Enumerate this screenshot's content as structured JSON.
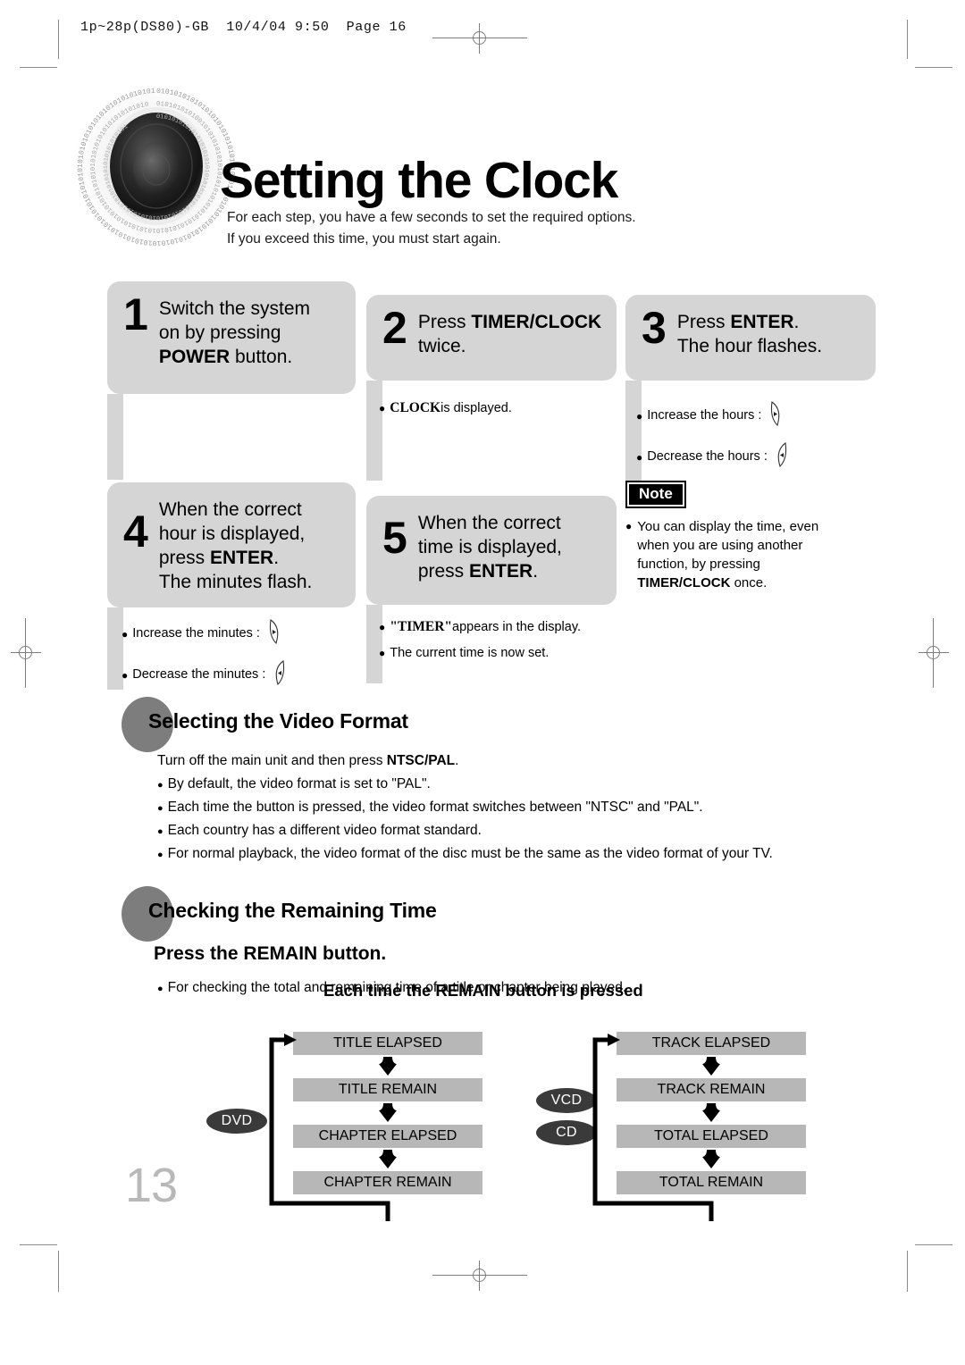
{
  "print_slug": "1p~28p(DS80)-GB  10/4/04 9:50  Page 16",
  "page_number": "13",
  "title": "Setting the Clock",
  "intro_line1": "For each step, you have a few seconds to set the required options.",
  "intro_line2": "If you exceed this time, you must start again.",
  "steps": [
    {
      "num": "1",
      "line1": "Switch the system",
      "line2": "on by pressing",
      "line3_bold": "POWER",
      "line3_rest": " button.",
      "notes": []
    },
    {
      "num": "2",
      "line1_pre": "Press ",
      "line1_bold": "TIMER/CLOCK",
      "line2": "twice.",
      "notes": [
        {
          "bold": "CLOCK",
          "rest": " is displayed."
        }
      ]
    },
    {
      "num": "3",
      "line1_pre": "Press ",
      "line1_bold": "ENTER",
      "line1_post": ".",
      "line2": "The hour flashes.",
      "notes": [
        {
          "label": "Increase the hours :",
          "key": "right-arrow-key-icon"
        },
        {
          "label": "Decrease the hours :",
          "key": "left-arrow-key-icon"
        }
      ]
    },
    {
      "num": "4",
      "line1": "When the correct",
      "line2": "hour is displayed,",
      "line3_pre": "press ",
      "line3_bold": "ENTER",
      "line3_post": ".",
      "line4": "The minutes flash.",
      "notes": [
        {
          "label": "Increase the minutes :",
          "key": "right-arrow-key-icon"
        },
        {
          "label": "Decrease the minutes :",
          "key": "left-arrow-key-icon"
        }
      ]
    },
    {
      "num": "5",
      "line1": "When the correct",
      "line2": "time is displayed,",
      "line3_pre": "press ",
      "line3_bold": "ENTER",
      "line3_post": ".",
      "notes": [
        {
          "bold": "\"TIMER\"",
          "rest": " appears in the display."
        },
        {
          "plain": "The current time is now set."
        }
      ]
    }
  ],
  "note": {
    "badge": "Note",
    "line1": "You can display the time, even",
    "line2": "when you are using another",
    "line3": "function, by pressing",
    "line4_bold": "TIMER/CLOCK",
    "line4_rest": " once."
  },
  "video_format": {
    "heading": "Selecting the Video Format",
    "intro_pre": "Turn off the main unit and then press ",
    "intro_bold": "NTSC/PAL",
    "intro_post": ".",
    "bullets": [
      "By default, the video format is set to \"PAL\".",
      "Each time the button is pressed, the video format switches between \"NTSC\" and \"PAL\".",
      "Each country has a different video format standard.",
      "For normal playback, the video format of the disc must be the same as the video format of your TV."
    ]
  },
  "remaining_time": {
    "heading": "Checking the Remaining Time",
    "subheading": "Press the REMAIN button.",
    "bullet": "For checking the total and remaining time of a title or chapter being played.",
    "flow_title": "Each time the REMAIN button is pressed",
    "columns": [
      {
        "badges": [
          "DVD"
        ],
        "boxes": [
          "TITLE ELAPSED",
          "TITLE REMAIN",
          "CHAPTER ELAPSED",
          "CHAPTER REMAIN"
        ]
      },
      {
        "badges": [
          "VCD",
          "CD"
        ],
        "boxes": [
          "TRACK ELAPSED",
          "TRACK REMAIN",
          "TOTAL ELAPSED",
          "TOTAL REMAIN"
        ]
      }
    ]
  },
  "colors": {
    "step_gray": "#d5d5d5",
    "flow_box_gray": "#b7b7b7",
    "badge_dark": "#3a3a3a",
    "heading_ellipse": "#7d7d7d",
    "page_number": "#b8b8b8"
  }
}
